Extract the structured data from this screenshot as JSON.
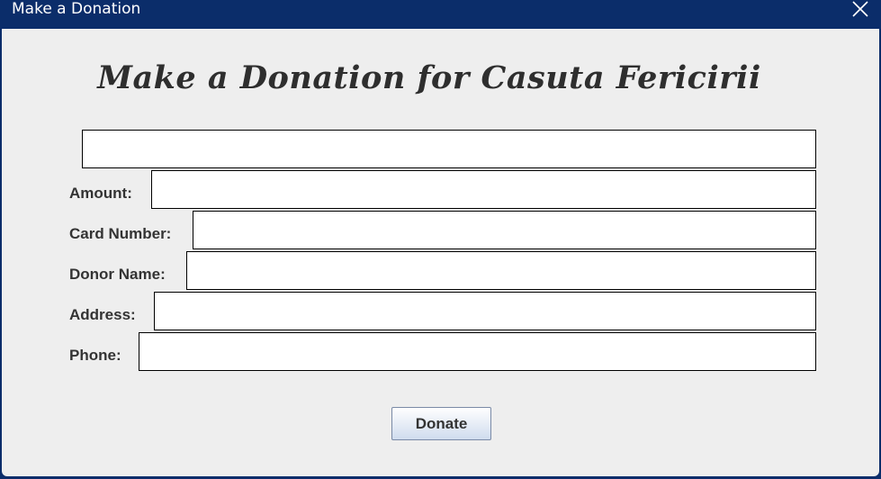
{
  "window": {
    "title": "Make a Donation",
    "close_icon": "close-icon"
  },
  "heading": "Make a Donation for Casuta Fericirii",
  "form": {
    "top_field": {
      "value": ""
    },
    "fields": [
      {
        "label": "Amount:",
        "value": ""
      },
      {
        "label": "Card Number:",
        "value": ""
      },
      {
        "label": "Donor Name:",
        "value": ""
      },
      {
        "label": "Address:",
        "value": ""
      },
      {
        "label": "Phone:",
        "value": ""
      }
    ],
    "donate_label": "Donate"
  },
  "colors": {
    "titlebar": "#0b2d6a",
    "background": "#eeeeee",
    "button_gradient_bottom": "#cfdcee"
  }
}
